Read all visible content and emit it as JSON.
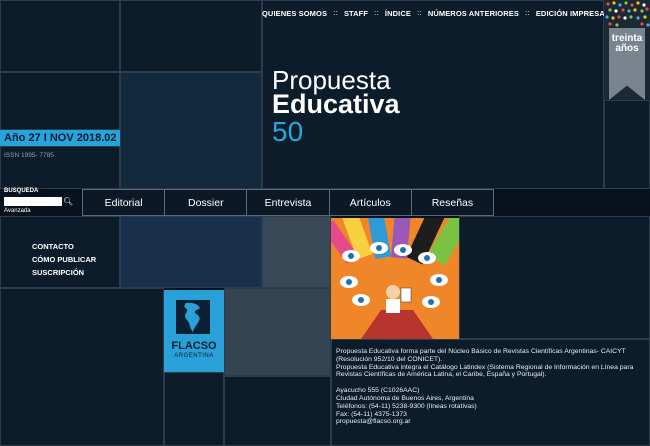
{
  "nav": {
    "items": [
      "QUIENES SOMOS",
      "STAFF",
      "ÍNDICE",
      "NÚMEROS ANTERIORES",
      "EDICIÓN IMPRESA"
    ],
    "separator": "::"
  },
  "badge": {
    "line1": "treinta",
    "line2": "años"
  },
  "title": {
    "line1": "Propuesta",
    "line2": "Educativa",
    "number": "50"
  },
  "issue": {
    "label": "Año 27 I NOV 2018.02",
    "issn": "ISSN 1995- 7785"
  },
  "search": {
    "label": "BUSQUEDA",
    "advanced": "Avanzada",
    "value": ""
  },
  "menu": [
    "Editorial",
    "Dossier",
    "Entrevista",
    "Artículos",
    "Reseñas"
  ],
  "side_links": [
    "CONTACTO",
    "CÓMO PUBLICAR",
    "SUSCRIPCIÓN"
  ],
  "flacso": {
    "name": "FLACSO",
    "country": "ARGENTINA"
  },
  "info": {
    "p1": "Propuesta Educativa forma parte del Núcleo Básico de Revistas Científicas Argentinas- CAICYT (Resolución 952/10 del CONICET).",
    "p2": "Propuesta Educativa integra el Catálogo Latindex (Sistema Regional de Información en Línea para Revistas Científicas de América Latina, el Caribe, España y Portugal).",
    "addr1": "Ayacucho 555 (C1026AAC)",
    "addr2": "Ciudad Autónoma de Buenos Aires, Argentina",
    "phone": "Teléfonos: (54-11) 5238-9300 (líneas rotativas)",
    "fax": "Fax: (54-11) 4375-1373",
    "email": "propuesta@flacso.org.ar"
  },
  "colors": {
    "accent": "#27a3db",
    "background": "#07121d"
  }
}
